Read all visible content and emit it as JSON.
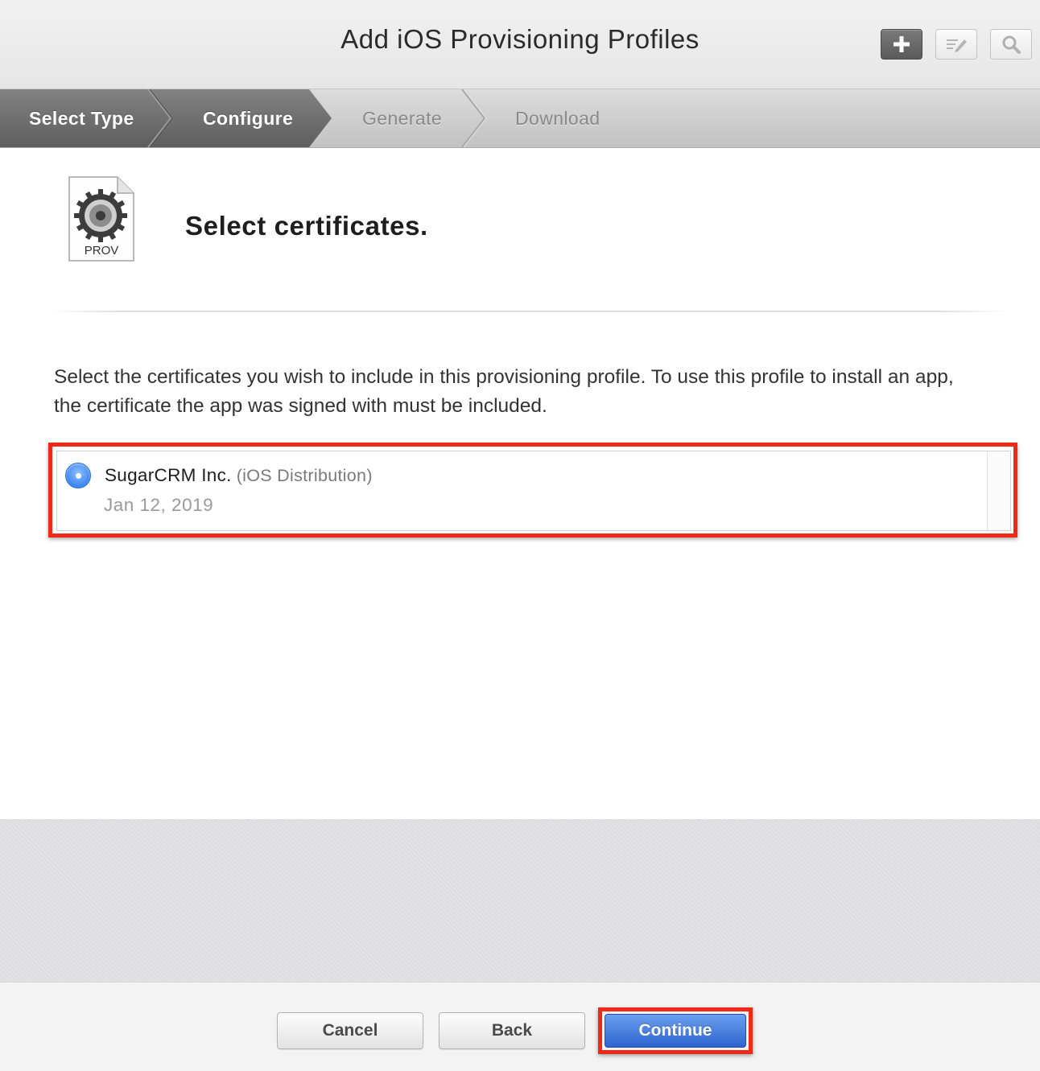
{
  "header": {
    "title": "Add iOS Provisioning Profiles",
    "toolbar": {
      "add_icon": "plus-icon",
      "edit_icon": "edit-icon",
      "search_icon": "search-icon"
    }
  },
  "steps": {
    "items": [
      {
        "label": "Select Type",
        "state": "complete"
      },
      {
        "label": "Configure",
        "state": "current"
      },
      {
        "label": "Generate",
        "state": "upcoming"
      },
      {
        "label": "Download",
        "state": "upcoming"
      }
    ]
  },
  "main": {
    "icon_label": "PROV",
    "title": "Select certificates.",
    "instructions": "Select the certificates you wish to include in this provisioning profile. To use this profile to install an app, the certificate the app was signed with must be included.",
    "certificates": [
      {
        "name": "SugarCRM Inc.",
        "type": "(iOS Distribution)",
        "date": "Jan 12, 2019",
        "selected": true
      }
    ]
  },
  "footer": {
    "cancel_label": "Cancel",
    "back_label": "Back",
    "continue_label": "Continue"
  },
  "colors": {
    "accent": "#2d64cf",
    "highlight": "#ee2a16",
    "step_active": "#6f6f6f"
  }
}
